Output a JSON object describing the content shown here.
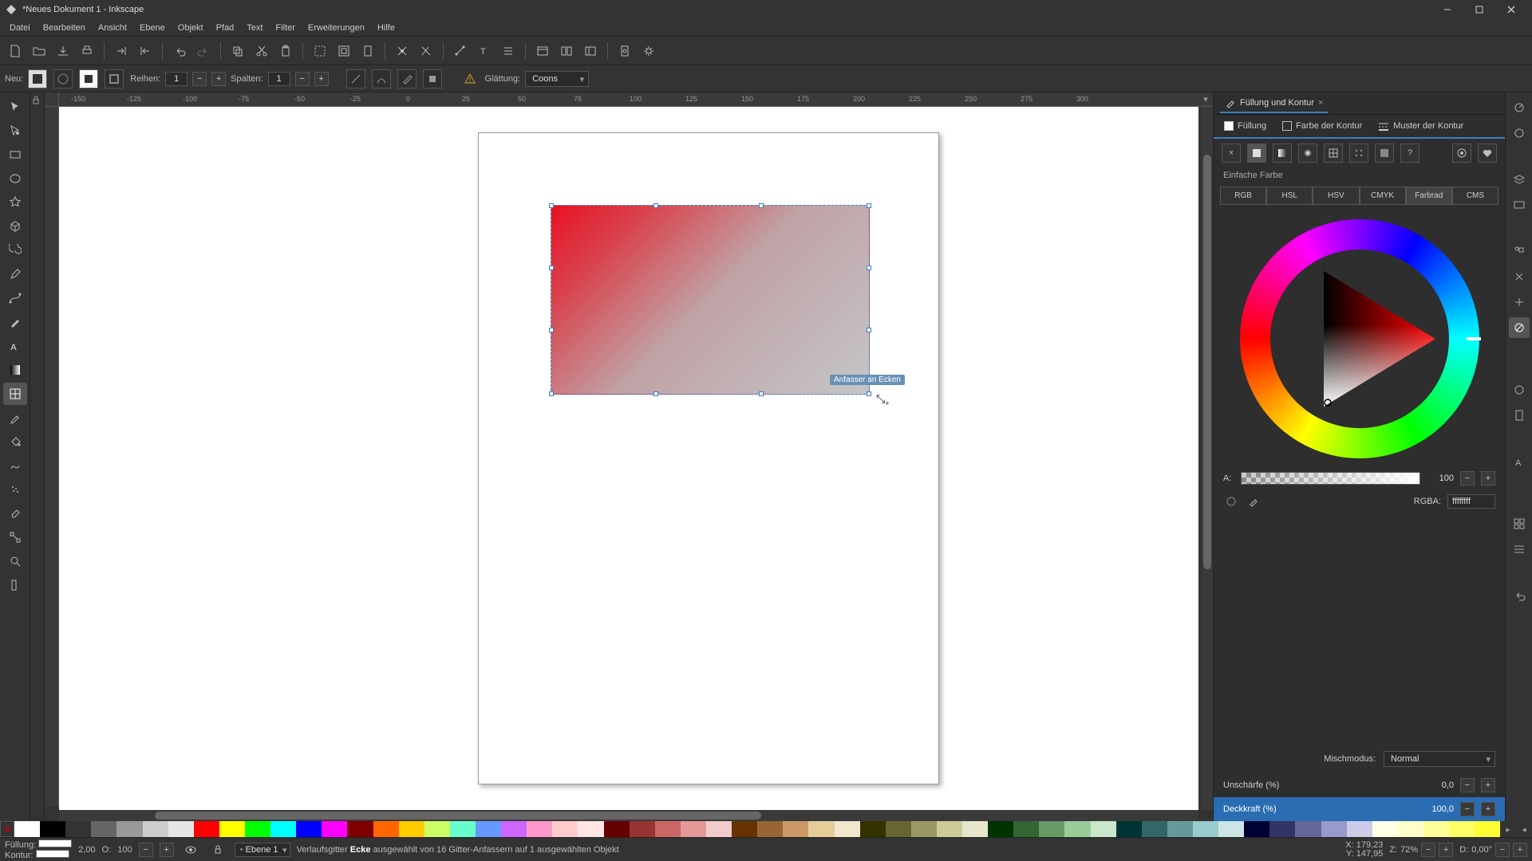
{
  "window": {
    "title": "*Neues Dokument 1 - Inkscape"
  },
  "menu": [
    "Datei",
    "Bearbeiten",
    "Ansicht",
    "Ebene",
    "Objekt",
    "Pfad",
    "Text",
    "Filter",
    "Erweiterungen",
    "Hilfe"
  ],
  "tool_options": {
    "new_label": "Neu:",
    "rows_label": "Reihen:",
    "rows_value": "1",
    "cols_label": "Spalten:",
    "cols_value": "1",
    "smoothing_label": "Glättung:",
    "smoothing_value": "Coons"
  },
  "ruler_ticks": [
    "-150",
    "-125",
    "-100",
    "-75",
    "-50",
    "-25",
    "0",
    "25",
    "50",
    "75",
    "100",
    "125",
    "150",
    "175",
    "200",
    "225",
    "250",
    "275",
    "300"
  ],
  "canvas": {
    "tooltip": "Anfasser an Ecken"
  },
  "panel": {
    "tab_title": "Füllung und Kontur",
    "fill_tab": "Füllung",
    "stroke_paint_tab": "Farbe der Kontur",
    "stroke_style_tab": "Muster der Kontur",
    "flat_color_label": "Einfache Farbe",
    "modes": [
      "RGB",
      "HSL",
      "HSV",
      "CMYK",
      "Farbrad",
      "CMS"
    ],
    "alpha_label": "A:",
    "alpha_value": "100",
    "rgba_label": "RGBA:",
    "rgba_value": "ffffffff",
    "blend_label": "Mischmodus:",
    "blend_value": "Normal",
    "blur_label": "Unschärfe (%)",
    "blur_value": "0,0",
    "opacity_label": "Deckkraft (%)",
    "opacity_value": "100,0"
  },
  "status": {
    "fill_label": "Füllung:",
    "stroke_label": "Kontur:",
    "stroke_width": "2,00",
    "opacity_label": "O:",
    "opacity_value": "100",
    "layer": "Ebene 1",
    "message_pre": "Verlaufsgitter ",
    "message_bold": "Ecke",
    "message_post": " ausgewählt von 16 Gitter-Anfassern auf 1 ausgewählten Objekt",
    "coord_x_label": "X:",
    "coord_x": "179,23",
    "coord_y_label": "Y:",
    "coord_y": "147,95",
    "zoom_label": "Z:",
    "zoom_value": "72%",
    "rot_label": "D:",
    "rot_value": "0,00°"
  },
  "palette": [
    "#ffffff",
    "#000000",
    "#333333",
    "#666666",
    "#999999",
    "#cccccc",
    "#e6e6e6",
    "#ff0000",
    "#ffff00",
    "#00ff00",
    "#00ffff",
    "#0000ff",
    "#ff00ff",
    "#800000",
    "#ff6600",
    "#ffcc00",
    "#ccff66",
    "#66ffcc",
    "#6699ff",
    "#cc66ff",
    "#ff99cc",
    "#ffcccc",
    "#ffe6e6",
    "#660000",
    "#993333",
    "#cc6666",
    "#e69999",
    "#f2cccc",
    "#663300",
    "#996633",
    "#cc9966",
    "#e6cc99",
    "#f2e6cc",
    "#333300",
    "#666633",
    "#999966",
    "#cccc99",
    "#e6e6cc",
    "#003300",
    "#336633",
    "#669966",
    "#99cc99",
    "#cce6cc",
    "#003333",
    "#336666",
    "#669999",
    "#99cccc",
    "#cce6e6",
    "#000033",
    "#333366",
    "#666699",
    "#9999cc",
    "#cccce6",
    "#ffffe6",
    "#ffffcc",
    "#ffff99",
    "#ffff66",
    "#ffff33"
  ]
}
